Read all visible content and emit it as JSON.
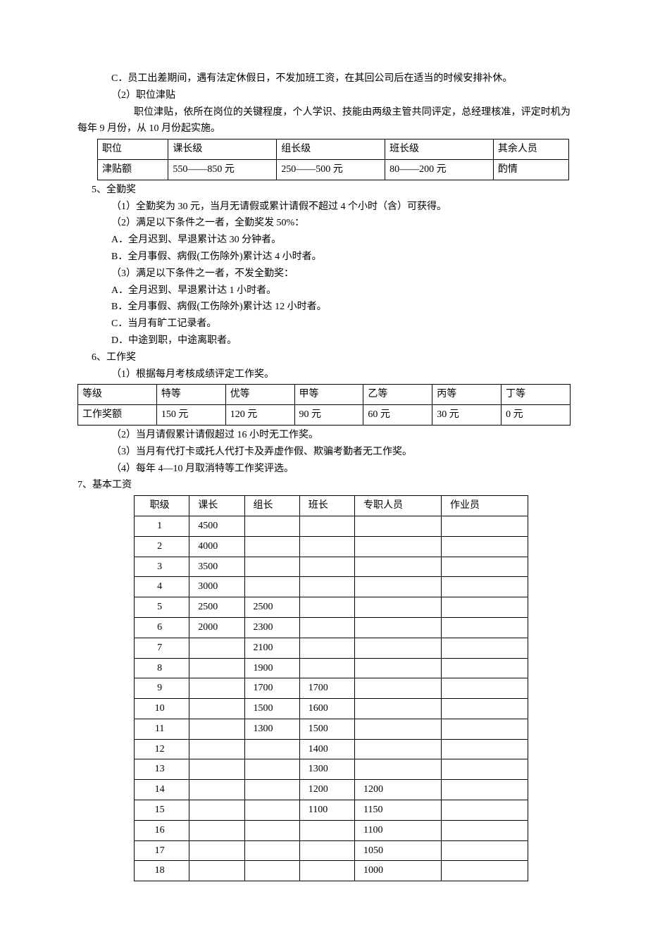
{
  "lines": {
    "c": "C．员工出差期间，遇有法定休假日，不发加班工资，在其回公司后在适当的时候安排补休。",
    "zwjt_title": "（2）职位津贴",
    "zwjt_desc": "职位津贴，依所在岗位的关键程度，个人学识、技能由两级主管共同评定，总经理核准，评定时机为每年 9 月份，从 10 月份起实施。",
    "h5": "5、全勤奖",
    "h5_1": "（1）全勤奖为 30 元，当月无请假或累计请假不超过 4 个小时（含）可获得。",
    "h5_2": "（2）满足以下条件之一者，全勤奖发 50%：",
    "h5_2a": "A．全月迟到、早退累计达 30 分钟者。",
    "h5_2b": "B．全月事假、病假(工伤除外)累计达 4 小时者。",
    "h5_3": "（3）满足以下条件之一者，不发全勤奖：",
    "h5_3a": "A．全月迟到、早退累计达 1 小时者。",
    "h5_3b": "B．全月事假、病假(工伤除外)累计达 12 小时者。",
    "h5_3c": "C．当月有旷工记录者。",
    "h5_3d": "D．中途到职，中途离职者。",
    "h6": "6、工作奖",
    "h6_1": "（1）根据每月考核成绩评定工作奖。",
    "h6_2": "（2）当月请假累计请假超过 16 小时无工作奖。",
    "h6_3": "（3）当月有代打卡或托人代打卡及弄虚作假、欺骗考勤者无工作奖。",
    "h6_4": "（4）每年 4—10 月取消特等工作奖评选。",
    "h7": "7、基本工资"
  },
  "table_allowance": {
    "headers": [
      "职位",
      "课长级",
      "组长级",
      "班长级",
      "其余人员"
    ],
    "row_label": "津贴额",
    "values": [
      "550——850 元",
      "250——500 元",
      "80——200 元",
      "酌情"
    ]
  },
  "table_grade": {
    "headers": [
      "等级",
      "特等",
      "优等",
      "甲等",
      "乙等",
      "丙等",
      "丁等"
    ],
    "row_label": "工作奖额",
    "values": [
      "150 元",
      "120 元",
      "90 元",
      "60 元",
      "30 元",
      "0 元"
    ]
  },
  "table_salary": {
    "headers": [
      "职级",
      "课长",
      "组长",
      "班长",
      "专职人员",
      "作业员"
    ],
    "rows": [
      [
        "1",
        "4500",
        "",
        "",
        "",
        ""
      ],
      [
        "2",
        "4000",
        "",
        "",
        "",
        ""
      ],
      [
        "3",
        "3500",
        "",
        "",
        "",
        ""
      ],
      [
        "4",
        "3000",
        "",
        "",
        "",
        ""
      ],
      [
        "5",
        "2500",
        "2500",
        "",
        "",
        ""
      ],
      [
        "6",
        "2000",
        "2300",
        "",
        "",
        ""
      ],
      [
        "7",
        "",
        "2100",
        "",
        "",
        ""
      ],
      [
        "8",
        "",
        "1900",
        "",
        "",
        ""
      ],
      [
        "9",
        "",
        "1700",
        "1700",
        "",
        ""
      ],
      [
        "10",
        "",
        "1500",
        "1600",
        "",
        ""
      ],
      [
        "11",
        "",
        "1300",
        "1500",
        "",
        ""
      ],
      [
        "12",
        "",
        "",
        "1400",
        "",
        ""
      ],
      [
        "13",
        "",
        "",
        "1300",
        "",
        ""
      ],
      [
        "14",
        "",
        "",
        "1200",
        "1200",
        ""
      ],
      [
        "15",
        "",
        "",
        "1100",
        "1150",
        ""
      ],
      [
        "16",
        "",
        "",
        "",
        "1100",
        ""
      ],
      [
        "17",
        "",
        "",
        "",
        "1050",
        ""
      ],
      [
        "18",
        "",
        "",
        "",
        "1000",
        ""
      ]
    ]
  }
}
